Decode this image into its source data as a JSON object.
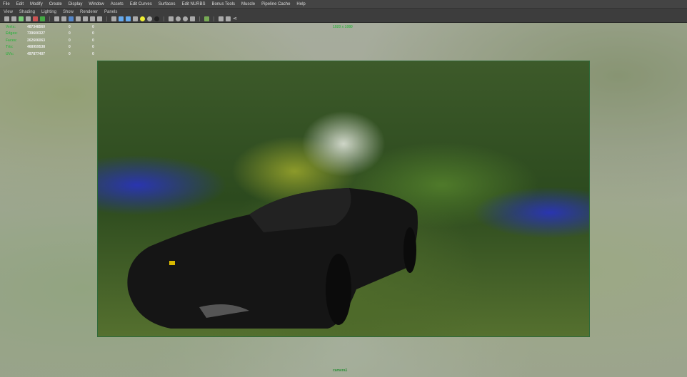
{
  "menubar": [
    "File",
    "Edit",
    "Modify",
    "Create",
    "Display",
    "Window",
    "Assets",
    "Edit Curves",
    "Surfaces",
    "Edit NURBS",
    "Bonus Tools",
    "Muscle",
    "Pipeline Cache",
    "Help"
  ],
  "panel_menu": [
    "View",
    "Shading",
    "Lighting",
    "Show",
    "Renderer",
    "Panels"
  ],
  "hud": {
    "rows": [
      {
        "label": "Verts:",
        "value": "487348560",
        "a": "0",
        "b": "0"
      },
      {
        "label": "Edges:",
        "value": "739600327",
        "a": "0",
        "b": "0"
      },
      {
        "label": "Faces:",
        "value": "262606063",
        "a": "0",
        "b": "0"
      },
      {
        "label": "Tris:",
        "value": "468959538",
        "a": "0",
        "b": "0"
      },
      {
        "label": "UVs:",
        "value": "497877407",
        "a": "0",
        "b": "0"
      }
    ]
  },
  "resolution": "1920 x 1080",
  "camera": "camera1"
}
